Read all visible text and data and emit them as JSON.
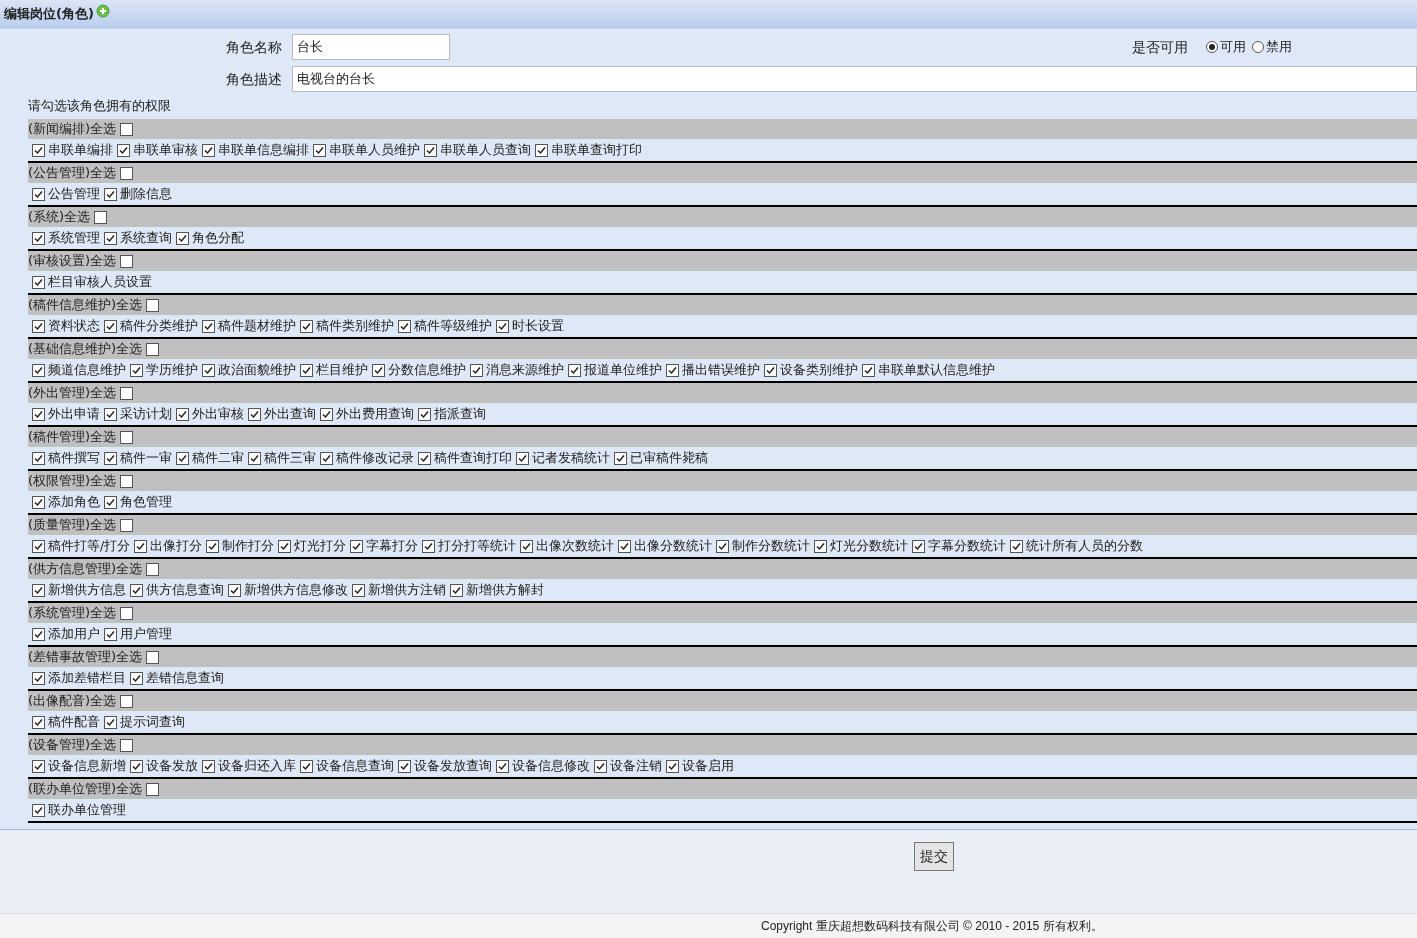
{
  "header": {
    "title": "编辑岗位(角色)"
  },
  "form": {
    "name_label": "角色名称",
    "name_value": "台长",
    "desc_label": "角色描述",
    "desc_value": "电视台的台长",
    "status_label": "是否可用",
    "status_options": [
      {
        "label": "可用",
        "selected": true
      },
      {
        "label": "禁用",
        "selected": false
      }
    ]
  },
  "permissions_prompt": "请勾选该角色拥有的权限",
  "groups": [
    {
      "title": "(新闻编排)全选",
      "checked": false,
      "items": [
        {
          "label": "串联单编排",
          "checked": true
        },
        {
          "label": "串联单审核",
          "checked": true
        },
        {
          "label": "串联单信息编排",
          "checked": true
        },
        {
          "label": "串联单人员维护",
          "checked": true
        },
        {
          "label": "串联单人员查询",
          "checked": true
        },
        {
          "label": "串联单查询打印",
          "checked": true
        }
      ]
    },
    {
      "title": "(公告管理)全选",
      "checked": false,
      "items": [
        {
          "label": "公告管理",
          "checked": true
        },
        {
          "label": "删除信息",
          "checked": true
        }
      ]
    },
    {
      "title": "(系统)全选",
      "checked": false,
      "items": [
        {
          "label": "系统管理",
          "checked": true
        },
        {
          "label": "系统查询",
          "checked": true
        },
        {
          "label": "角色分配",
          "checked": true
        }
      ]
    },
    {
      "title": "(审核设置)全选",
      "checked": false,
      "items": [
        {
          "label": "栏目审核人员设置",
          "checked": true
        }
      ]
    },
    {
      "title": "(稿件信息维护)全选",
      "checked": false,
      "items": [
        {
          "label": "资料状态",
          "checked": true
        },
        {
          "label": "稿件分类维护",
          "checked": true
        },
        {
          "label": "稿件题材维护",
          "checked": true
        },
        {
          "label": "稿件类别维护",
          "checked": true
        },
        {
          "label": "稿件等级维护",
          "checked": true
        },
        {
          "label": "时长设置",
          "checked": true
        }
      ]
    },
    {
      "title": "(基础信息维护)全选",
      "checked": false,
      "items": [
        {
          "label": "频道信息维护",
          "checked": true
        },
        {
          "label": "学历维护",
          "checked": true
        },
        {
          "label": "政治面貌维护",
          "checked": true
        },
        {
          "label": "栏目维护",
          "checked": true
        },
        {
          "label": "分数信息维护",
          "checked": true
        },
        {
          "label": "消息来源维护",
          "checked": true
        },
        {
          "label": "报道单位维护",
          "checked": true
        },
        {
          "label": "播出错误维护",
          "checked": true
        },
        {
          "label": "设备类别维护",
          "checked": true
        },
        {
          "label": "串联单默认信息维护",
          "checked": true
        }
      ]
    },
    {
      "title": "(外出管理)全选",
      "checked": false,
      "items": [
        {
          "label": "外出申请",
          "checked": true
        },
        {
          "label": "采访计划",
          "checked": true
        },
        {
          "label": "外出审核",
          "checked": true
        },
        {
          "label": "外出查询",
          "checked": true
        },
        {
          "label": "外出费用查询",
          "checked": true
        },
        {
          "label": "指派查询",
          "checked": true
        }
      ]
    },
    {
      "title": "(稿件管理)全选",
      "checked": false,
      "items": [
        {
          "label": "稿件撰写",
          "checked": true
        },
        {
          "label": "稿件一审",
          "checked": true
        },
        {
          "label": "稿件二审",
          "checked": true
        },
        {
          "label": "稿件三审",
          "checked": true
        },
        {
          "label": "稿件修改记录",
          "checked": true
        },
        {
          "label": "稿件查询打印",
          "checked": true
        },
        {
          "label": "记者发稿统计",
          "checked": true
        },
        {
          "label": "已审稿件毙稿",
          "checked": true
        }
      ]
    },
    {
      "title": "(权限管理)全选",
      "checked": false,
      "items": [
        {
          "label": "添加角色",
          "checked": true
        },
        {
          "label": "角色管理",
          "checked": true
        }
      ]
    },
    {
      "title": "(质量管理)全选",
      "checked": false,
      "items": [
        {
          "label": "稿件打等/打分",
          "checked": true
        },
        {
          "label": "出像打分",
          "checked": true
        },
        {
          "label": "制作打分",
          "checked": true
        },
        {
          "label": "灯光打分",
          "checked": true
        },
        {
          "label": "字幕打分",
          "checked": true
        },
        {
          "label": "打分打等统计",
          "checked": true
        },
        {
          "label": "出像次数统计",
          "checked": true
        },
        {
          "label": "出像分数统计",
          "checked": true
        },
        {
          "label": "制作分数统计",
          "checked": true
        },
        {
          "label": "灯光分数统计",
          "checked": true
        },
        {
          "label": "字幕分数统计",
          "checked": true
        },
        {
          "label": "统计所有人员的分数",
          "checked": true
        }
      ]
    },
    {
      "title": "(供方信息管理)全选",
      "checked": false,
      "items": [
        {
          "label": "新增供方信息",
          "checked": true
        },
        {
          "label": "供方信息查询",
          "checked": true
        },
        {
          "label": "新增供方信息修改",
          "checked": true
        },
        {
          "label": "新增供方注销",
          "checked": true
        },
        {
          "label": "新增供方解封",
          "checked": true
        }
      ]
    },
    {
      "title": "(系统管理)全选",
      "checked": false,
      "items": [
        {
          "label": "添加用户",
          "checked": true
        },
        {
          "label": "用户管理",
          "checked": true
        }
      ]
    },
    {
      "title": "(差错事故管理)全选",
      "checked": false,
      "items": [
        {
          "label": "添加差错栏目",
          "checked": true
        },
        {
          "label": "差错信息查询",
          "checked": true
        }
      ]
    },
    {
      "title": "(出像配音)全选",
      "checked": false,
      "items": [
        {
          "label": "稿件配音",
          "checked": true
        },
        {
          "label": "提示词查询",
          "checked": true
        }
      ]
    },
    {
      "title": "(设备管理)全选",
      "checked": false,
      "items": [
        {
          "label": "设备信息新增",
          "checked": true
        },
        {
          "label": "设备发放",
          "checked": true
        },
        {
          "label": "设备归还入库",
          "checked": true
        },
        {
          "label": "设备信息查询",
          "checked": true
        },
        {
          "label": "设备发放查询",
          "checked": true
        },
        {
          "label": "设备信息修改",
          "checked": true
        },
        {
          "label": "设备注销",
          "checked": true
        },
        {
          "label": "设备启用",
          "checked": true
        }
      ]
    },
    {
      "title": "(联办单位管理)全选",
      "checked": false,
      "items": [
        {
          "label": "联办单位管理",
          "checked": true
        }
      ]
    }
  ],
  "submit_label": "提交",
  "footer": "Copyright 重庆超想数码科技有限公司 © 2010 - 2015 所有权利。"
}
